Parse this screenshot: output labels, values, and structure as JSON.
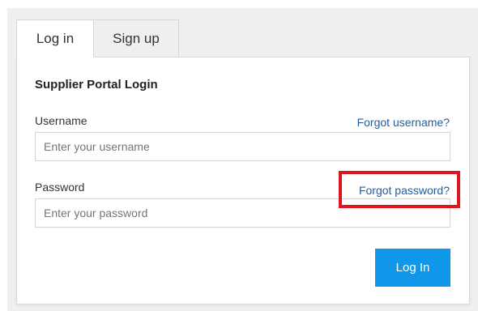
{
  "tabs": [
    {
      "label": "Log in",
      "active": true
    },
    {
      "label": "Sign up",
      "active": false
    }
  ],
  "form": {
    "title": "Supplier Portal Login",
    "username": {
      "label": "Username",
      "forgot_link": "Forgot username?",
      "placeholder": "Enter your username",
      "value": ""
    },
    "password": {
      "label": "Password",
      "forgot_link": "Forgot password?",
      "placeholder": "Enter your password",
      "value": ""
    },
    "submit_label": "Log In"
  },
  "annotation": {
    "highlighted_element": "forgot-password-link",
    "color": "#e0161f"
  },
  "colors": {
    "accent": "#1197ea",
    "link": "#1d5fa6",
    "background": "#efefef"
  }
}
